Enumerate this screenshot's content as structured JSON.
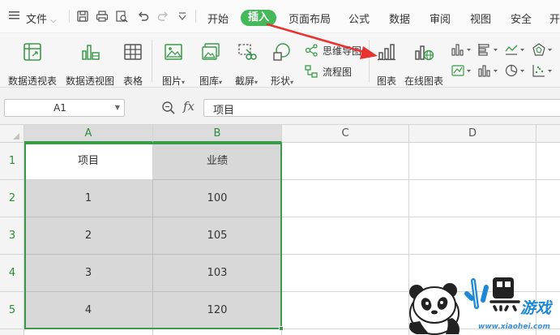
{
  "menubar": {
    "file_label": "文件",
    "tabs": [
      {
        "label": "开始"
      },
      {
        "label": "插入"
      },
      {
        "label": "页面布局"
      },
      {
        "label": "公式"
      },
      {
        "label": "数据"
      },
      {
        "label": "审阅"
      },
      {
        "label": "视图"
      },
      {
        "label": "安全"
      },
      {
        "label": "开"
      }
    ],
    "active_tab": "插入",
    "active_color": "#45b85a"
  },
  "ribbon": {
    "buttons": [
      {
        "label": "数据透视表",
        "icon": "pivot-table-icon"
      },
      {
        "label": "数据透视图",
        "icon": "pivot-chart-icon"
      },
      {
        "label": "表格",
        "icon": "table-icon"
      },
      {
        "label": "图片",
        "icon": "picture-icon"
      },
      {
        "label": "图库",
        "icon": "gallery-icon"
      },
      {
        "label": "截屏",
        "icon": "screenshot-icon"
      },
      {
        "label": "形状",
        "icon": "shapes-icon"
      },
      {
        "label": "图表",
        "icon": "chart-icon"
      },
      {
        "label": "在线图表",
        "icon": "online-chart-icon"
      }
    ],
    "small_items": [
      {
        "label": "思维导图",
        "icon": "mindmap-icon"
      },
      {
        "label": "流程图",
        "icon": "flowchart-icon"
      }
    ]
  },
  "formula_bar": {
    "name_box": "A1",
    "fx_label": "fx",
    "formula_value": "项目"
  },
  "sheet": {
    "columns": [
      "A",
      "B",
      "C",
      "D"
    ],
    "rows": [
      "1",
      "2",
      "3",
      "4",
      "5"
    ],
    "data": [
      [
        "项目",
        "业绩"
      ],
      [
        "1",
        "100"
      ],
      [
        "2",
        "105"
      ],
      [
        "3",
        "103"
      ],
      [
        "4",
        "120"
      ]
    ],
    "selection_color": "#3d9a4c"
  },
  "watermark": {
    "url_text": "www.xiaohei.com"
  }
}
